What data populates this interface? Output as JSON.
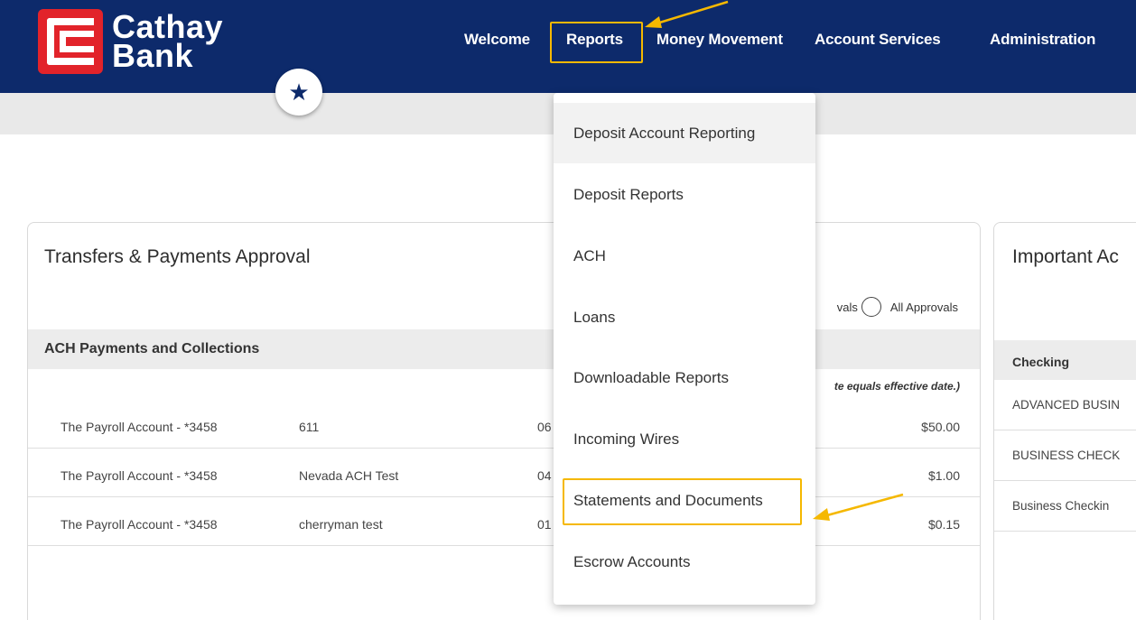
{
  "brand": {
    "line1": "Cathay",
    "line2": "Bank"
  },
  "nav": {
    "items": [
      "Welcome",
      "Reports",
      "Money Movement",
      "Account Services",
      "Administration"
    ]
  },
  "reports_menu": {
    "items": [
      "Deposit Account Reporting",
      "Deposit Reports",
      "ACH",
      "Loans",
      "Downloadable Reports",
      "Incoming Wires",
      "Statements and Documents",
      "Escrow Accounts"
    ]
  },
  "approvals_card": {
    "title": "Transfers & Payments Approval",
    "filter_partial": "vals",
    "filter_all": "All Approvals",
    "section": "ACH Payments and Collections",
    "note": "te equals effective date.)",
    "rows": [
      {
        "account": "The Payroll Account - *3458",
        "name": "611",
        "date": "06",
        "amount": "$50.00"
      },
      {
        "account": "The Payroll Account - *3458",
        "name": "Nevada ACH Test",
        "date": "04",
        "amount": "$1.00"
      },
      {
        "account": "The Payroll Account - *3458",
        "name": "cherryman test",
        "date": "01",
        "amount": "$0.15"
      }
    ]
  },
  "important_card": {
    "title": "Important Ac",
    "section": "Checking",
    "rows": [
      "ADVANCED BUSIN",
      "BUSINESS CHECK",
      "Business Checkin"
    ]
  },
  "colors": {
    "header": "#0d2a6b",
    "brand_red": "#e2232a",
    "highlight": "#f5b800"
  },
  "icons": {
    "favorite": "star-icon"
  }
}
